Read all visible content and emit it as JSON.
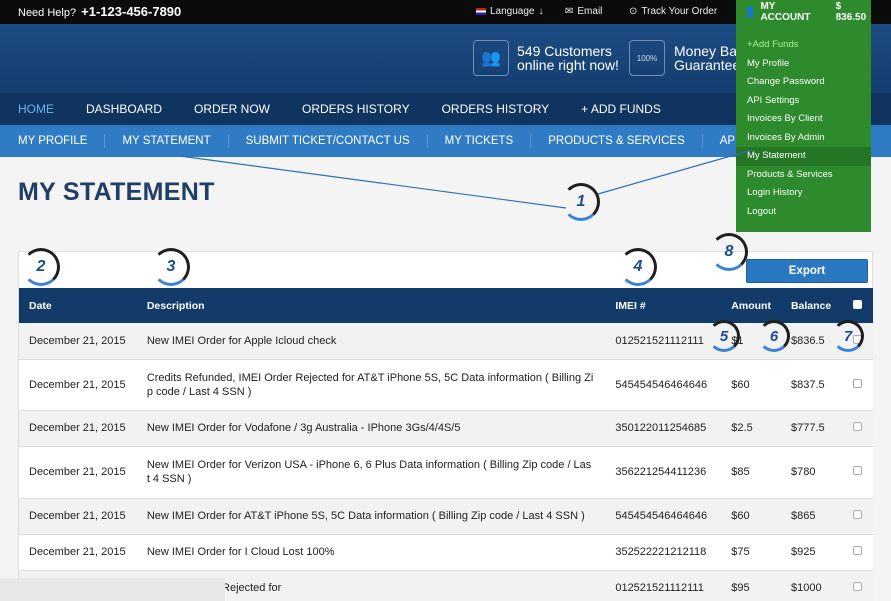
{
  "topbar": {
    "help_label": "Need Help?",
    "phone": "+1-123-456-7890",
    "language": "Language",
    "email": "Email",
    "track": "Track Your Order",
    "account_label": "MY ACCOUNT",
    "balance": "$ 836.50"
  },
  "header": {
    "customers_line1": "549 Customers",
    "customers_line2": "online right now!",
    "money_line1": "Money Bac",
    "money_line2": "Guarantee",
    "money_badge": "100%"
  },
  "main_nav": [
    "HOME",
    "DASHBOARD",
    "ORDER NOW",
    "ORDERS HISTORY",
    "ORDERS HISTORY",
    "+ ADD FUNDS"
  ],
  "sub_nav": [
    "MY PROFILE",
    "MY STATEMENT",
    "SUBMIT TICKET/CONTACT US",
    "MY TICKETS",
    "PRODUCTS & SERVICES",
    "API SETTINGS"
  ],
  "page_title": "MY STATEMENT",
  "dropdown": [
    "+Add Funds",
    "My Profile",
    "Change Password",
    "API Settings",
    "Invoices By Client",
    "Invoices By Admin",
    "My Statement",
    "Products & Services",
    "Login History",
    "Logout"
  ],
  "export_label": "Export",
  "table": {
    "headers": [
      "Date",
      "Description",
      "IMEI #",
      "Amount",
      "Balance"
    ],
    "rows": [
      {
        "date": "December 21, 2015",
        "desc": "New IMEI Order for Apple Icloud check",
        "imei": "012521521112111",
        "amount": "$1",
        "balance": "$836.5"
      },
      {
        "date": "December 21, 2015",
        "desc": "Credits Refunded, IMEI Order Rejected for AT&T iPhone 5S, 5C Data information ( Billing Zi p code / Last 4 SSN )",
        "imei": "545454546464646",
        "amount": "$60",
        "balance": "$837.5"
      },
      {
        "date": "December 21, 2015",
        "desc": "New IMEI Order for Vodafone / 3g Australia - IPhone 3Gs/4/4S/5",
        "imei": "350122011254685",
        "amount": "$2.5",
        "balance": "$777.5"
      },
      {
        "date": "December 21, 2015",
        "desc": "New IMEI Order for Verizon USA - iPhone 6, 6 Plus Data information ( Billing Zip code / Las t 4 SSN )",
        "imei": "356221254411236",
        "amount": "$85",
        "balance": "$780"
      },
      {
        "date": "December 21, 2015",
        "desc": "New IMEI Order for AT&T iPhone 5S, 5C Data information ( Billing Zip code / Last 4 SSN )",
        "imei": "545454546464646",
        "amount": "$60",
        "balance": "$865"
      },
      {
        "date": "December 21, 2015",
        "desc": "New IMEI Order for I Cloud Lost 100%",
        "imei": "352522221212118",
        "amount": "$75",
        "balance": "$925"
      },
      {
        "date": "",
        "desc": "ed, IMEI Order Rejected for",
        "imei": "012521521112111",
        "amount": "$95",
        "balance": "$1000"
      }
    ]
  },
  "markers": [
    "1",
    "2",
    "3",
    "4",
    "5",
    "6",
    "7",
    "8"
  ]
}
